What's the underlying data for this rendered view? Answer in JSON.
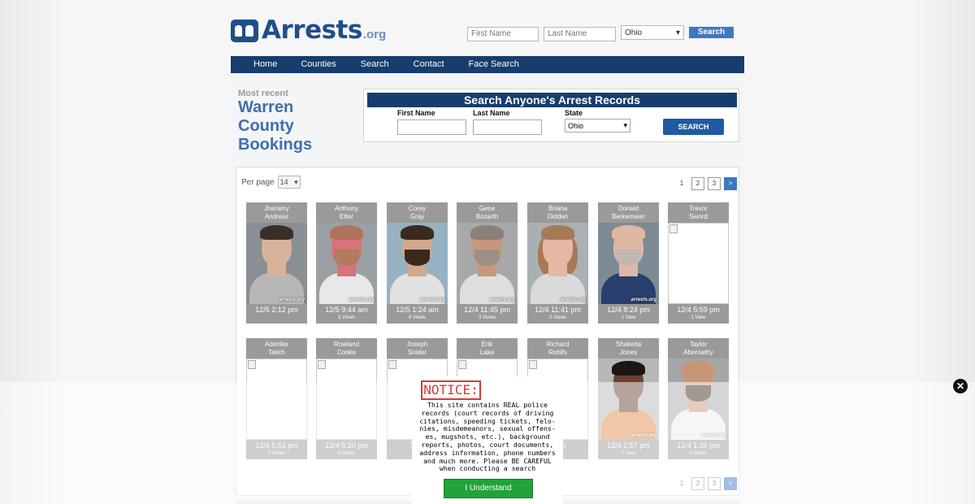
{
  "site": {
    "logo_text": "Arrests",
    "logo_suffix": ".org"
  },
  "header_search": {
    "first_name_placeholder": "First Name",
    "last_name_placeholder": "Last Name",
    "state_value": "Ohio",
    "search_label": "Search"
  },
  "nav": {
    "items": [
      "Home",
      "Counties",
      "Search",
      "Contact",
      "Face Search"
    ]
  },
  "heading": {
    "most_recent": "Most recent",
    "county_lines": [
      "Warren",
      "County",
      "Bookings"
    ]
  },
  "search_box": {
    "title": "Search Anyone's Arrest Records",
    "first_name_label": "First Name",
    "last_name_label": "Last Name",
    "state_label": "State",
    "state_value": "Ohio",
    "button_label": "SEARCH"
  },
  "listing": {
    "per_page_label": "Per page",
    "per_page_value": "14",
    "pagination": [
      "1",
      "2",
      "3",
      ">"
    ],
    "bookings": [
      {
        "first": "Jheramy",
        "last": "Andress",
        "time": "12/5 2:12 pm",
        "views": "",
        "photo": "tattoo"
      },
      {
        "first": "Anthony",
        "last": "Etter",
        "time": "12/5 9:44 am",
        "views": "3 Views",
        "photo": "red"
      },
      {
        "first": "Corey",
        "last": "Gray",
        "time": "12/5 1:24 am",
        "views": "6 Views",
        "photo": "beard"
      },
      {
        "first": "Gene",
        "last": "Bozarth",
        "time": "12/4 11:45 pm",
        "views": "3 Views",
        "photo": "grey"
      },
      {
        "first": "Briana",
        "last": "Didden",
        "time": "12/4 11:41 pm",
        "views": "2 Views",
        "photo": "woman"
      },
      {
        "first": "Donald",
        "last": "Berkemeier",
        "time": "12/4 8:24 pm",
        "views": "1 View",
        "photo": "bald"
      },
      {
        "first": "Trevor",
        "last": "Sword",
        "time": "12/4 5:59 pm",
        "views": "1 View",
        "photo": "none"
      },
      {
        "first": "Adenike",
        "last": "Telich",
        "time": "12/4 5:53 pm",
        "views": "2 Views",
        "photo": "none"
      },
      {
        "first": "Rowland",
        "last": "Cooke",
        "time": "12/4 5:20 pm",
        "views": "2 Views",
        "photo": "none"
      },
      {
        "first": "Joseph",
        "last": "Snider",
        "time": "12/4",
        "views": "",
        "photo": "none"
      },
      {
        "first": "Erik",
        "last": "Lake",
        "time": "",
        "views": "",
        "photo": "none"
      },
      {
        "first": "Richard",
        "last": "Rohlfs",
        "time": "2 pm",
        "views": "",
        "photo": "none"
      },
      {
        "first": "Shakeita",
        "last": "Jones",
        "time": "12/4 2:57 pm",
        "views": "1 View",
        "photo": "woman2"
      },
      {
        "first": "Taylor",
        "last": "Abernathy",
        "time": "12/4 1:35 pm",
        "views": "2 Views",
        "photo": "bald2"
      }
    ]
  },
  "watermark": "arrests.org",
  "notice": {
    "title": "NOTICE:",
    "lines": [
      "This site contains REAL police",
      "records (court records of driving",
      "citations, speeding tickets, felo-",
      "nies, misdemeanors, sexual offens-",
      "es, mugshots, etc.), background",
      "reports, photos, court documents,",
      "address information, phone numbers",
      "and much more. Please BE CAREFUL",
      "when conducting a search"
    ],
    "button_label": "I Understand"
  },
  "close_icon": "close-icon"
}
